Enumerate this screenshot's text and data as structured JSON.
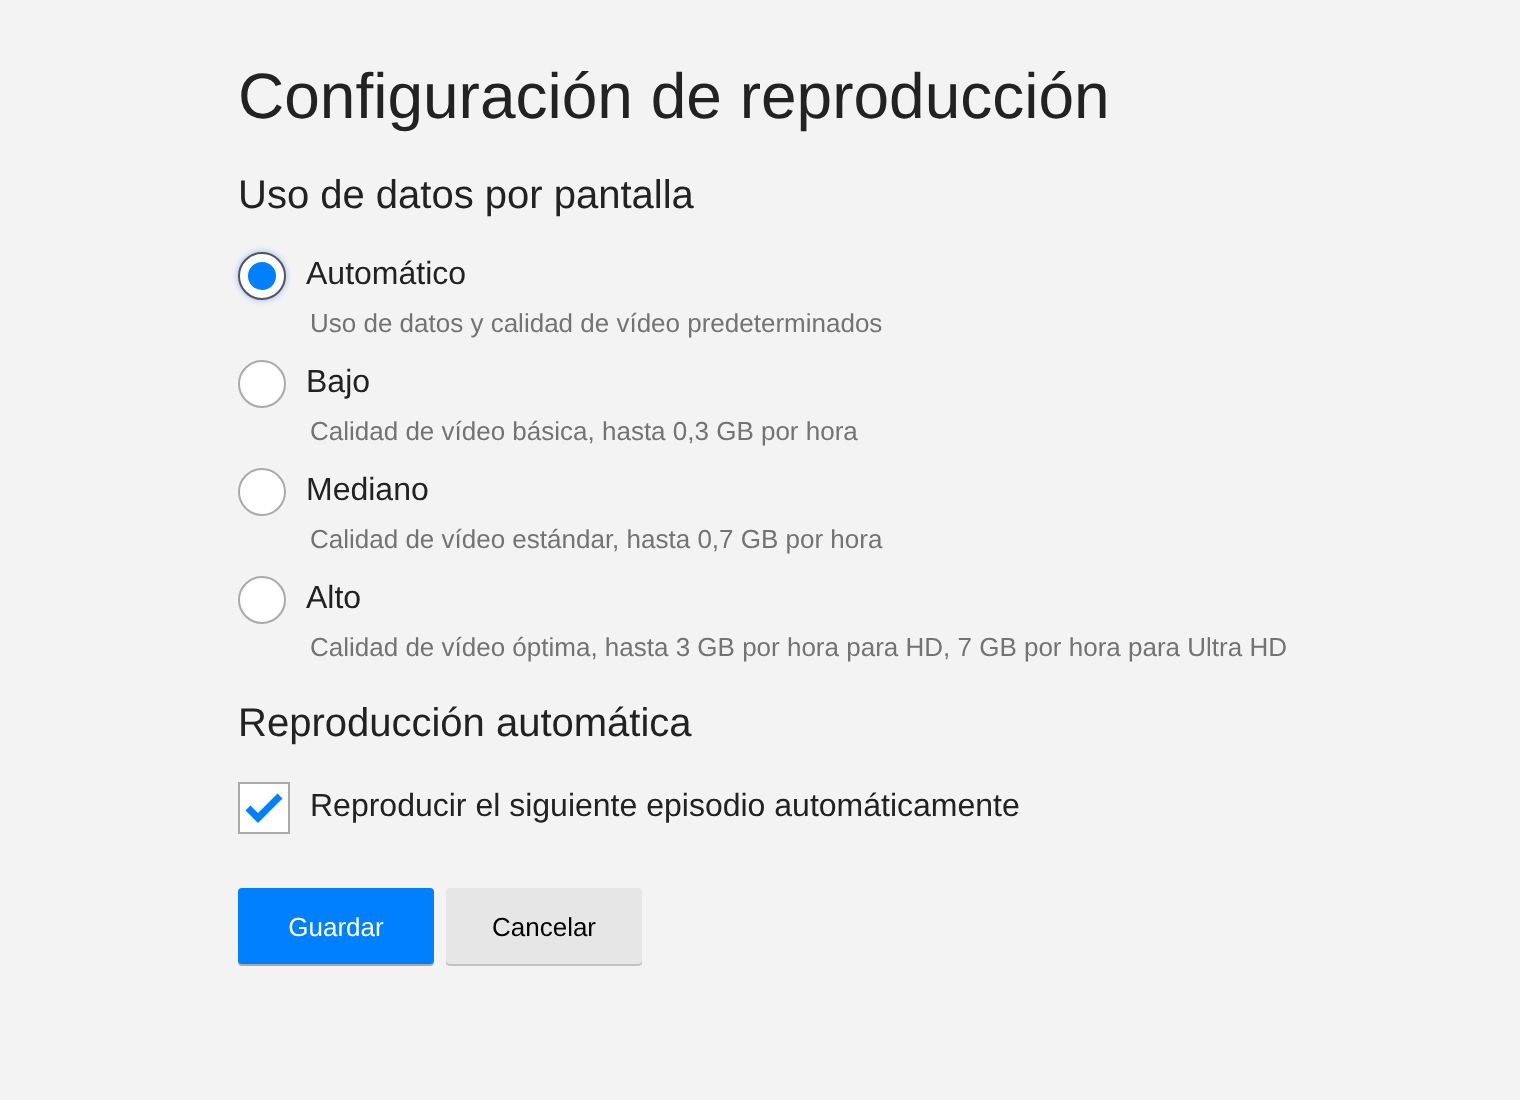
{
  "title": "Configuración de reproducción",
  "data_usage": {
    "heading": "Uso de datos por pantalla",
    "options": [
      {
        "label": "Automático",
        "description": "Uso de datos y calidad de vídeo predeterminados",
        "selected": true
      },
      {
        "label": "Bajo",
        "description": "Calidad de vídeo básica, hasta 0,3 GB por hora",
        "selected": false
      },
      {
        "label": "Mediano",
        "description": "Calidad de vídeo estándar, hasta 0,7 GB por hora",
        "selected": false
      },
      {
        "label": "Alto",
        "description": "Calidad de vídeo óptima, hasta 3 GB por hora para HD, 7 GB por hora para Ultra HD",
        "selected": false
      }
    ]
  },
  "autoplay": {
    "heading": "Reproducción automática",
    "label": "Reproducir el siguiente episodio automáticamente",
    "checked": true
  },
  "buttons": [
    {
      "label": "Guardar",
      "kind": "primary"
    },
    {
      "label": "Cancelar",
      "kind": "secondary"
    }
  ]
}
